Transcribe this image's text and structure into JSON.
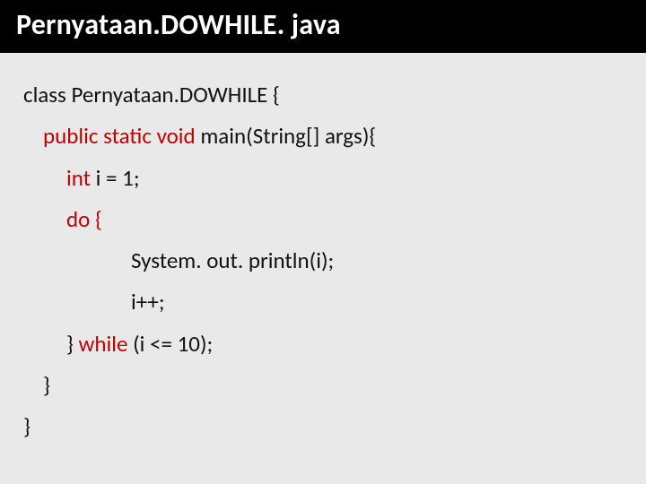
{
  "title": "Pernyataan.DOWHILE. java",
  "code": {
    "line1": "class Pernyataan.DOWHILE {",
    "line2_prefix": "public static void",
    "line2_rest": " main(String[] args){",
    "line3_prefix": "int",
    "line3_rest": " i = 1;",
    "line4": "do {",
    "line5": "System. out. println(i);",
    "line6": "i++;",
    "line7_prefix": "} ",
    "line7_kw": "while",
    "line7_rest": " (i <= 10);",
    "line8": "}",
    "line9": "}"
  }
}
